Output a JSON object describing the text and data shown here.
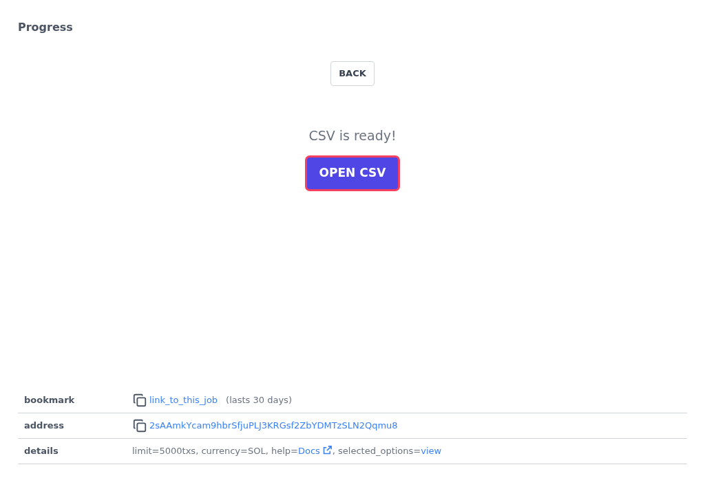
{
  "title": "Progress",
  "back_button": "BACK",
  "status_message": "CSV is ready!",
  "open_button": {
    "label": "OPEN CSV",
    "focused": true
  },
  "info_rows": [
    {
      "label": "bookmark",
      "kind": "copy_link",
      "link": "link_to_this_job",
      "note": "(lasts 30 days)"
    },
    {
      "label": "address",
      "kind": "copy_link",
      "link": "2sAAmkYcam9hbrSfjuPLJ3KRGsf2ZbYDMTzSLN2Qqmu8"
    },
    {
      "label": "details",
      "kind": "parts",
      "parts": [
        {
          "kind": "text",
          "text": "limit=5000txs, currency=SOL, help="
        },
        {
          "kind": "external_link",
          "text": "Docs"
        },
        {
          "kind": "text",
          "text": ", selected_options="
        },
        {
          "kind": "link",
          "text": "view"
        }
      ]
    }
  ]
}
